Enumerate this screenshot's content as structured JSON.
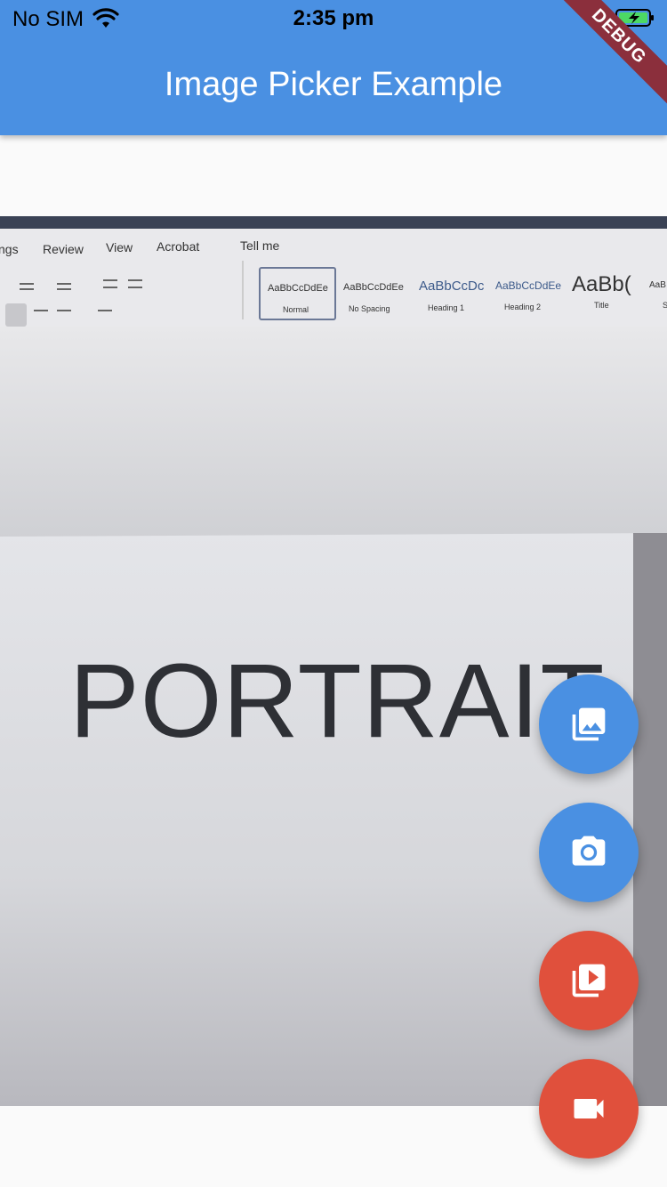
{
  "status_bar": {
    "carrier": "No SIM",
    "time": "2:35 pm"
  },
  "app_bar": {
    "title": "Image Picker Example"
  },
  "debug_banner": "DEBUG",
  "photo": {
    "toolbar_tabs": [
      "ngs",
      "Review",
      "View",
      "Acrobat",
      "Tell me"
    ],
    "styles": [
      {
        "sample": "AaBbCcDdEe",
        "name": "Normal"
      },
      {
        "sample": "AaBbCcDdEe",
        "name": "No Spacing"
      },
      {
        "sample": "AaBbCcDc",
        "name": "Heading 1"
      },
      {
        "sample": "AaBbCcDdEe",
        "name": "Heading 2"
      },
      {
        "sample": "AaBb(",
        "name": "Title"
      },
      {
        "sample": "AaB",
        "name": "S"
      }
    ],
    "document_text": "PORTRAIT"
  },
  "fabs": [
    {
      "icon": "photo-library-icon",
      "color": "#4a90e2"
    },
    {
      "icon": "camera-icon",
      "color": "#4a90e2"
    },
    {
      "icon": "video-library-icon",
      "color": "#e0503c"
    },
    {
      "icon": "videocam-icon",
      "color": "#e0503c"
    }
  ]
}
